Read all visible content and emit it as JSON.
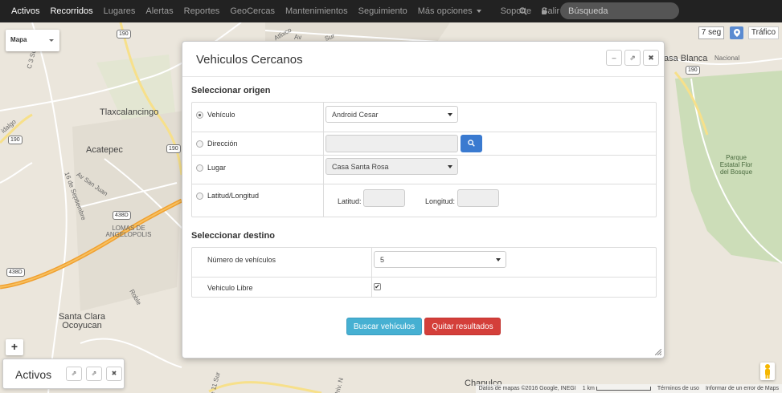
{
  "navbar": {
    "items": [
      {
        "label": "Activos",
        "active": true
      },
      {
        "label": "Recorridos",
        "active": true
      },
      {
        "label": "Lugares",
        "active": false
      },
      {
        "label": "Alertas",
        "active": false
      },
      {
        "label": "Reportes",
        "active": false
      },
      {
        "label": "GeoCercas",
        "active": false
      },
      {
        "label": "Mantenimientos",
        "active": false
      },
      {
        "label": "Seguimiento",
        "active": false
      },
      {
        "label": "Más opciones",
        "active": false
      },
      {
        "label": "Soporte",
        "active": false
      },
      {
        "label": "Salir",
        "active": false
      }
    ],
    "search_placeholder": "Búsqueda",
    "search_value": "",
    "search_icon": "search-icon",
    "lock_icon": "lock-icon"
  },
  "map": {
    "type_select": "Mapa",
    "refresh_label": "7 seg",
    "pin_icon": "map-marker-icon",
    "traffic_label": "Tráfico",
    "zoom_in_label": "+",
    "pegman_icon": "street-view-icon",
    "labels": {
      "tlaxcalancingo": "Tlaxcalancingo",
      "acatepec": "Acatepec",
      "santa_clara": "Santa Clara\nOcoyucan",
      "chapulco": "Chapulco",
      "casa_blanca": "asa Blanca",
      "nacional": "Nacional",
      "parque": "Parque\nEstatal Flor\ndel Bosque",
      "lomas": "LOMAS DE\nANGELOPOLIS",
      "av_san_juan": "Av San Juan",
      "septiembre": "16 de Septiembre",
      "robles": "Roble",
      "cerro": "C 3 Sur",
      "hidalgo": "idalgo",
      "atlixco": "Atlixco",
      "av": "Av",
      "sur": "Sur",
      "calle_11_sur": "de 11 Sur",
      "priv": "Priv. N",
      "shields": [
        "190",
        "190",
        "190",
        "438D",
        "438D",
        "190"
      ]
    },
    "footer": {
      "data": "Datos de mapas ©2016 Google, INEGI",
      "scale": "1 km",
      "terms": "Términos de uso",
      "report": "Informar de un error de Maps"
    }
  },
  "activos_panel": {
    "title": "Activos",
    "buttons": [
      "external-link-icon",
      "external-link-icon",
      "close-icon"
    ]
  },
  "modal": {
    "title": "Vehiculos Cercanos",
    "header_buttons": {
      "minimize": "–",
      "popout": "⇗",
      "close": "✖"
    },
    "origin": {
      "section_title": "Seleccionar origen",
      "options": [
        {
          "label": "Vehículo",
          "checked": true
        },
        {
          "label": "Dirección",
          "checked": false
        },
        {
          "label": "Lugar",
          "checked": false
        },
        {
          "label": "Latitud/Longitud",
          "checked": false
        }
      ],
      "vehicle_select": "Android Cesar",
      "address_value": "",
      "place_select": "Casa Santa Rosa",
      "lat_label": "Latitud:",
      "lng_label": "Longitud:",
      "lat_value": "",
      "lng_value": ""
    },
    "destination": {
      "section_title": "Seleccionar destino",
      "num_vehicles_label": "Número de vehículos",
      "num_vehicles_value": "5",
      "free_vehicle_label": "Vehiculo Libre",
      "free_vehicle_checked": true
    },
    "buttons": {
      "search": "Buscar vehículos",
      "clear": "Quitar resultados"
    }
  },
  "colors": {
    "navbar_bg": "#222222",
    "primary": "#46b0d2",
    "danger": "#d43f3a",
    "search_btn": "#3a7ad0",
    "highway": "#f0a030"
  }
}
